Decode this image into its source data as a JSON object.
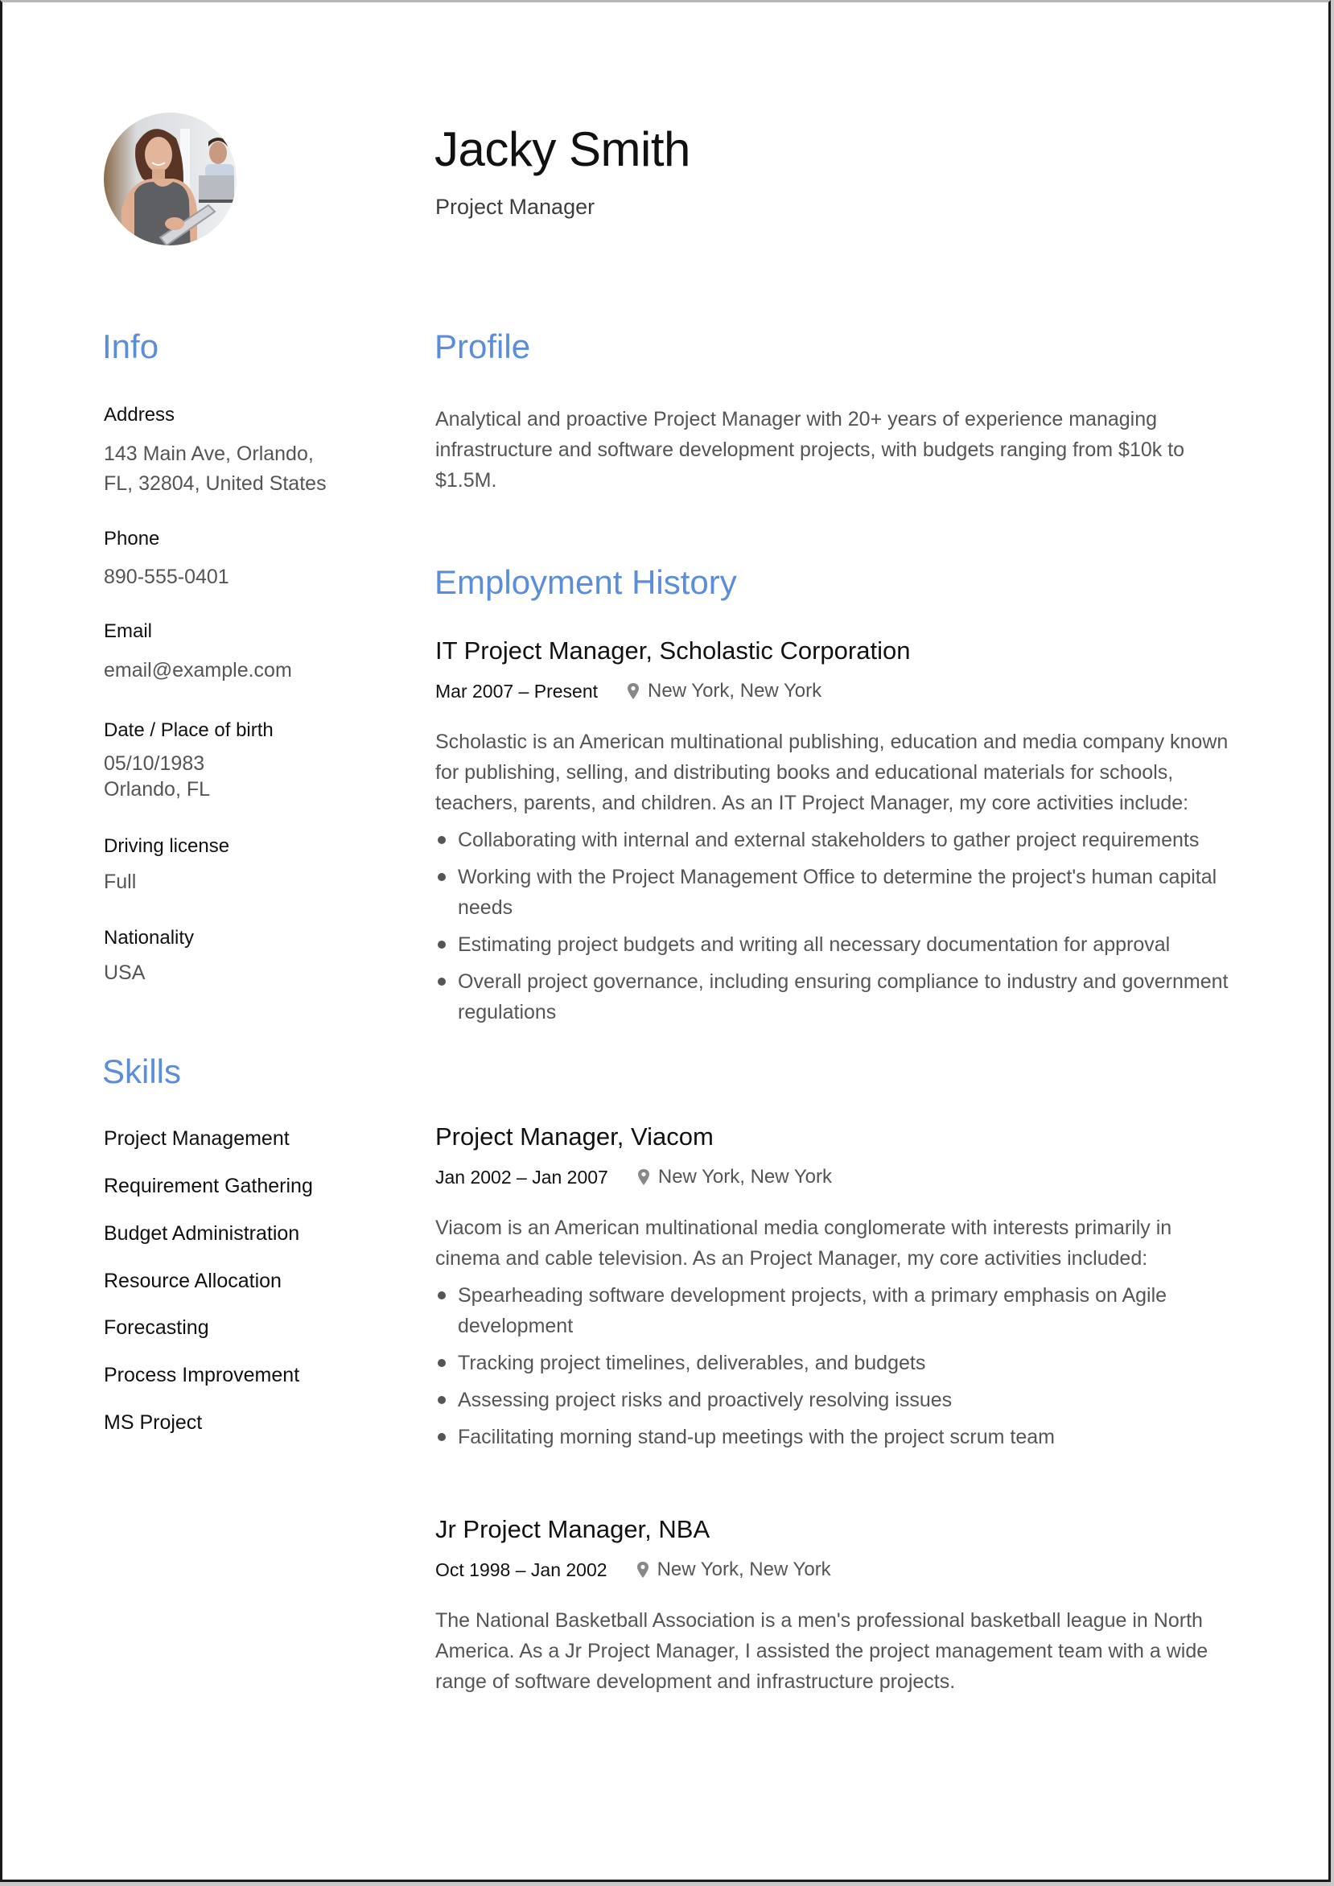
{
  "header": {
    "name": "Jacky Smith",
    "title": "Project Manager",
    "photo_alt": "profile-photo"
  },
  "colors": {
    "accent": "#5b8dd9",
    "text_dark": "#111111",
    "text_muted": "#555555"
  },
  "info": {
    "heading": "Info",
    "items": [
      {
        "label": "Address",
        "lines": [
          "143 Main Ave, Orlando,",
          "FL, 32804, United States"
        ]
      },
      {
        "label": "Phone",
        "lines": [
          "890-555-0401"
        ]
      },
      {
        "label": "Email",
        "lines": [
          "email@example.com"
        ]
      },
      {
        "label": "Date / Place of birth",
        "lines": [
          "05/10/1983",
          "Orlando, FL"
        ]
      },
      {
        "label": "Driving license",
        "lines": [
          "Full"
        ]
      },
      {
        "label": "Nationality",
        "lines": [
          "USA"
        ]
      }
    ]
  },
  "skills": {
    "heading": "Skills",
    "items": [
      "Project Management",
      "Requirement Gathering",
      "Budget Administration",
      "Resource Allocation",
      "Forecasting",
      "Process Improvement",
      "MS Project"
    ]
  },
  "profile": {
    "heading": "Profile",
    "text": "Analytical and proactive Project Manager with 20+ years of experience managing infrastructure and software development projects, with budgets ranging from $10k to $1.5M."
  },
  "employment": {
    "heading": "Employment History",
    "jobs": [
      {
        "title": "IT Project Manager, Scholastic Corporation",
        "dates": "Mar 2007 – Present",
        "location": "New York, New York",
        "description": "Scholastic is an American multinational publishing, education and media company known for publishing, selling, and distributing books and educational materials for schools, teachers, parents, and children. As an IT Project Manager, my core activities include:",
        "bullets": [
          "Collaborating with internal and external stakeholders to gather project requirements",
          "Working with the Project Management Office to determine the project's human capital needs",
          "Estimating project budgets and writing all necessary documentation for approval",
          "Overall project governance, including ensuring compliance to industry and government regulations"
        ]
      },
      {
        "title": "Project Manager, Viacom",
        "dates": "Jan 2002 – Jan 2007",
        "location": "New York, New York",
        "description": "Viacom is an American multinational media conglomerate with interests primarily in cinema and cable television. As an Project Manager, my core activities included:",
        "bullets": [
          "Spearheading software development projects, with a primary emphasis on Agile development",
          "Tracking project timelines, deliverables, and budgets",
          "Assessing project risks and proactively resolving issues",
          "Facilitating morning stand-up meetings with the project scrum team"
        ]
      },
      {
        "title": "Jr Project Manager, NBA",
        "dates": "Oct 1998 – Jan 2002",
        "location": "New York, New York",
        "description": "The National Basketball Association is a men's professional basketball league in North America. As a Jr Project Manager, I assisted the project management team with a wide range of software development and infrastructure projects.",
        "bullets": []
      }
    ]
  }
}
